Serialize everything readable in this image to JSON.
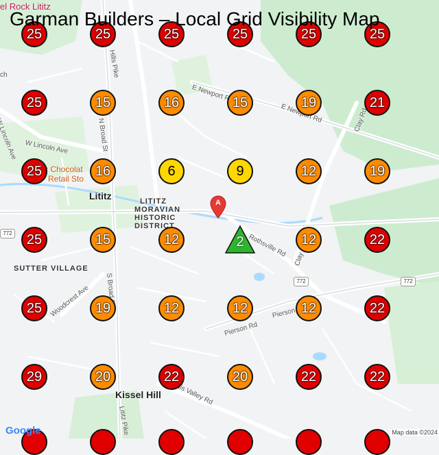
{
  "title": "Garman Builders – Local Grid Visibility Map",
  "colors": {
    "red": "#e00000",
    "orange": "#ff8c00",
    "yellow": "#ffd700",
    "green": "#2db52d",
    "pin": "#e53935"
  },
  "center_marker": {
    "value": "2",
    "color": "green",
    "shape": "triangle"
  },
  "pin": {
    "label": "A"
  },
  "grid": [
    [
      "25",
      "25",
      "25",
      "25",
      "25",
      "25"
    ],
    [
      "25",
      "15",
      "16",
      "15",
      "19",
      "21"
    ],
    [
      "25",
      "16",
      "6",
      "9",
      "12",
      "19"
    ],
    [
      "25",
      "15",
      "12",
      "",
      "12",
      "22"
    ],
    [
      "25",
      "19",
      "12",
      "12",
      "12",
      "22"
    ],
    [
      "29",
      "20",
      "22",
      "20",
      "22",
      "22"
    ],
    [
      "",
      "",
      "",
      "",
      "",
      ""
    ]
  ],
  "grid_colors": [
    [
      "red",
      "red",
      "red",
      "red",
      "red",
      "red"
    ],
    [
      "red",
      "orange",
      "orange",
      "orange",
      "orange",
      "red"
    ],
    [
      "red",
      "orange",
      "yellow",
      "yellow",
      "orange",
      "orange"
    ],
    [
      "red",
      "orange",
      "orange",
      "",
      "orange",
      "red"
    ],
    [
      "red",
      "orange",
      "orange",
      "orange",
      "orange",
      "red"
    ],
    [
      "red",
      "orange",
      "red",
      "orange",
      "red",
      "red"
    ],
    [
      "red",
      "red",
      "red",
      "red",
      "red",
      "red"
    ]
  ],
  "map_labels": {
    "rock_lititz": "el Rock Lititz",
    "church": "ch",
    "w_lincoln_ave": "W Lincoln Ave",
    "w_lincoln_ave_2": "W Lincoln Ave",
    "hills_pike": "Hills Pike",
    "n_broad_st": "N Broad St",
    "e_newport_rd": "E Newport Rd",
    "e_newport_rd_2": "E Newport Rd",
    "clay_rd": "Clay Rd",
    "chocolate": "r Chocolat",
    "retail_store": "Retail Sto",
    "lititz": "Lititz",
    "historic_1": "LITITZ",
    "historic_2": "MORAVIAN",
    "historic_3": "HISTORIC",
    "historic_4": "DISTRICT",
    "sutter_village": "SUTTER VILLAGE",
    "woodcrest_ave": "Woodcrest Ave",
    "s_broad_st": "S Broad St",
    "rothsville_rd": "Rothsville Rd",
    "clay_rd_2": "Clay Rd",
    "pierson_rd": "Pierson Rd",
    "pierson_rd_2": "Pierson",
    "kissel_hill": "Kissel Hill",
    "lititz_pike": "Lititz Pike",
    "valley_rd": "dis Valley Rd",
    "route_772_a": "772",
    "route_772_b": "772",
    "route_772_c": "772"
  },
  "footer": {
    "google": "Google",
    "credit": "Map data ©2024"
  }
}
